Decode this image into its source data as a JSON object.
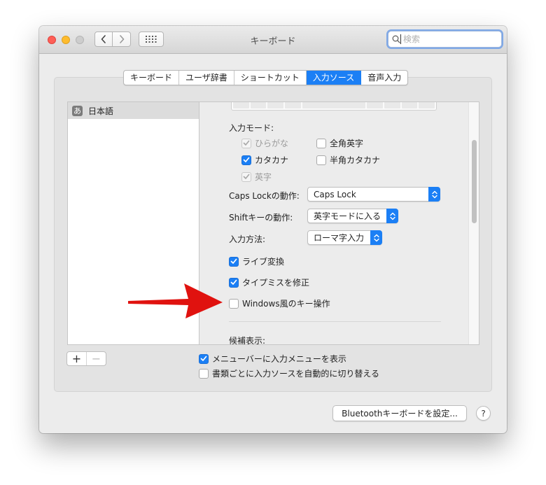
{
  "window": {
    "title": "キーボード"
  },
  "search": {
    "placeholder": "検索"
  },
  "tabs": [
    {
      "label": "キーボード",
      "active": false
    },
    {
      "label": "ユーザ辞書",
      "active": false
    },
    {
      "label": "ショートカット",
      "active": false
    },
    {
      "label": "入力ソース",
      "active": true
    },
    {
      "label": "音声入力",
      "active": false
    }
  ],
  "sources": [
    {
      "icon_char": "あ",
      "label": "日本語",
      "selected": true
    }
  ],
  "input_mode": {
    "heading": "入力モード:",
    "options": [
      {
        "label": "ひらがな",
        "checked": true,
        "disabled": true
      },
      {
        "label": "全角英字",
        "checked": false,
        "disabled": false
      },
      {
        "label": "カタカナ",
        "checked": true,
        "disabled": false
      },
      {
        "label": "半角カタカナ",
        "checked": false,
        "disabled": false
      },
      {
        "label": "英字",
        "checked": true,
        "disabled": true
      }
    ]
  },
  "caps_lock": {
    "label": "Caps Lockの動作:",
    "value": "Caps Lock"
  },
  "shift": {
    "label": "Shiftキーの動作:",
    "value": "英字モードに入る"
  },
  "input_method": {
    "label": "入力方法:",
    "value": "ローマ字入力"
  },
  "options": [
    {
      "label": "ライブ変換",
      "checked": true
    },
    {
      "label": "タイプミスを修正",
      "checked": true
    },
    {
      "label": "Windows風のキー操作",
      "checked": false
    }
  ],
  "candidates": {
    "heading": "候補表示:"
  },
  "bottom_options": [
    {
      "label": "メニューバーに入力メニューを表示",
      "checked": true
    },
    {
      "label": "書類ごとに入力ソースを自動的に切り替える",
      "checked": false
    }
  ],
  "list_controls": {
    "add": "+",
    "remove": "−"
  },
  "bluetooth_button": {
    "label": "Bluetoothキーボードを設定..."
  },
  "help_button": {
    "label": "?"
  },
  "colors": {
    "accent": "#1b7ff5",
    "annotation_arrow": "#e0120f",
    "close": "#fe5f57",
    "minimize": "#febc2e"
  },
  "icons": {
    "back": "chevron-left-icon",
    "forward": "chevron-right-icon",
    "grid": "grid-icon",
    "search": "search-icon",
    "checkmark": "checkmark-icon",
    "stepper": "up-down-chevron-icon"
  }
}
